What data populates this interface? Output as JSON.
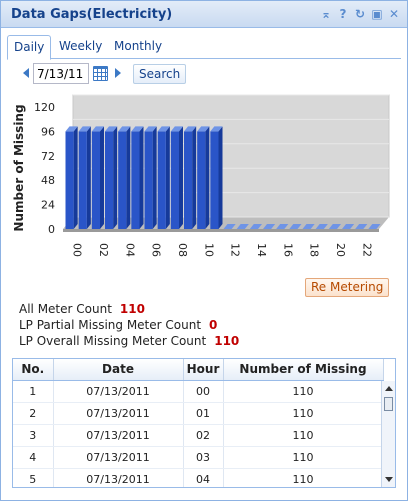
{
  "window": {
    "title": "Data Gaps(Electricity)"
  },
  "tabs": [
    {
      "label": "Daily"
    },
    {
      "label": "Weekly"
    },
    {
      "label": "Monthly"
    }
  ],
  "toolbar": {
    "date_value": "7/13/11",
    "search_label": "Search"
  },
  "chart_data": {
    "type": "bar",
    "categories": [
      "00",
      "01",
      "02",
      "03",
      "04",
      "05",
      "06",
      "07",
      "08",
      "09",
      "10",
      "11",
      "12",
      "13",
      "14",
      "15",
      "16",
      "17",
      "18",
      "19",
      "20",
      "21",
      "22",
      "23"
    ],
    "category_labels_shown": [
      "00",
      "02",
      "04",
      "06",
      "08",
      "10",
      "12",
      "14",
      "16",
      "18",
      "20",
      "22"
    ],
    "values": [
      96,
      96,
      96,
      96,
      96,
      96,
      96,
      96,
      96,
      96,
      96,
      96,
      0,
      0,
      0,
      0,
      0,
      0,
      0,
      0,
      0,
      0,
      0,
      0
    ],
    "ylabel": "Number of Missing",
    "ylim": [
      0,
      120
    ],
    "yticks": [
      0,
      24,
      48,
      72,
      96,
      120
    ],
    "colors": {
      "bar": "#2a55c8",
      "bar_top": "#6f94e6",
      "bar_side": "#163a9a",
      "back_wall": "#d8d8d8"
    }
  },
  "actions": {
    "remetering_label": "Re Metering"
  },
  "stats": [
    {
      "label": "All Meter Count",
      "value": "110"
    },
    {
      "label": "LP Partial Missing Meter Count",
      "value": "0"
    },
    {
      "label": "LP Overall Missing Meter Count",
      "value": "110"
    }
  ],
  "grid": {
    "columns": [
      "No.",
      "Date",
      "Hour",
      "Number of Missing"
    ],
    "rows": [
      [
        "1",
        "07/13/2011",
        "00",
        "110"
      ],
      [
        "2",
        "07/13/2011",
        "01",
        "110"
      ],
      [
        "3",
        "07/13/2011",
        "02",
        "110"
      ],
      [
        "4",
        "07/13/2011",
        "03",
        "110"
      ],
      [
        "5",
        "07/13/2011",
        "04",
        "110"
      ]
    ]
  }
}
